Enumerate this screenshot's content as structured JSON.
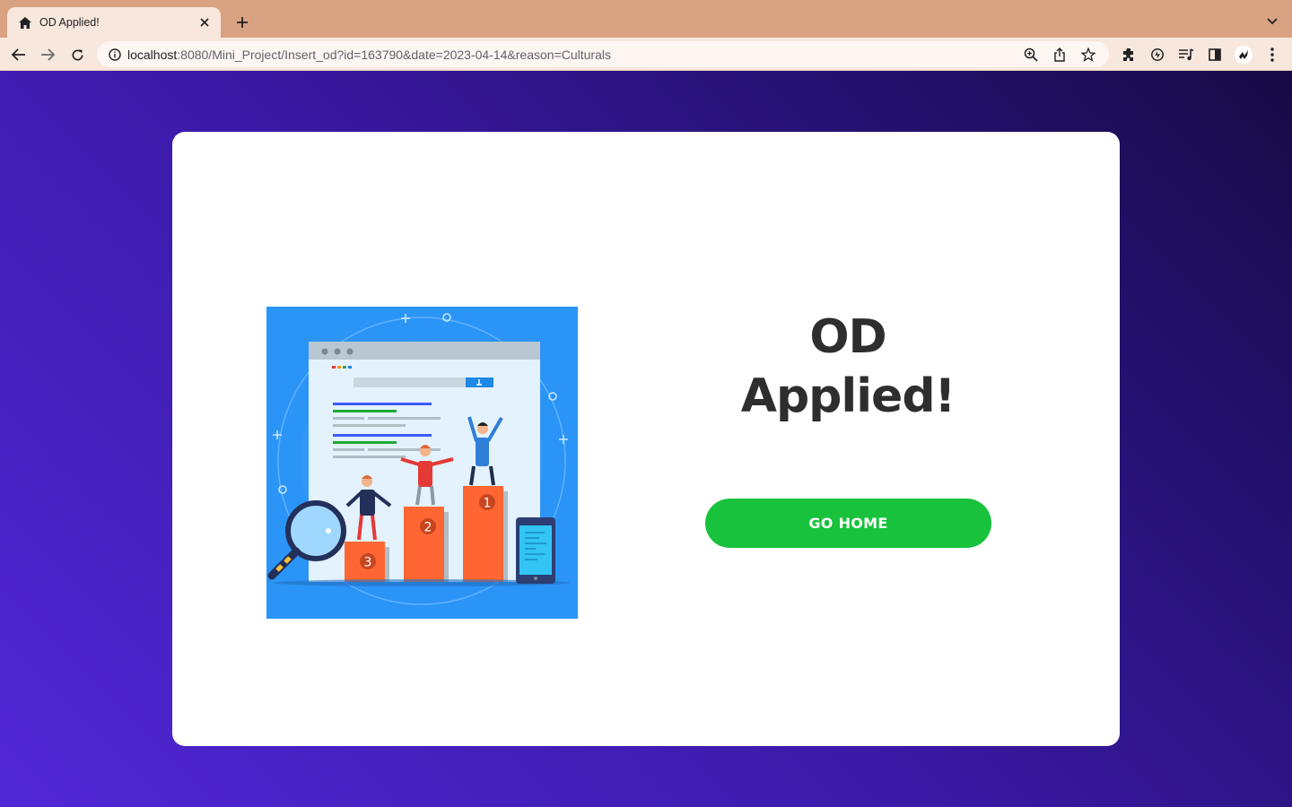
{
  "browser": {
    "tab_title": "OD Applied!",
    "url_host": "localhost",
    "url_rest": ":8080/Mini_Project/Insert_od?id=163790&date=2023-04-14&reason=Culturals",
    "icons": [
      "home-icon",
      "close-icon",
      "plus-icon",
      "chevron-down-icon",
      "back-arrow-icon",
      "forward-arrow-icon",
      "reload-icon",
      "info-icon",
      "zoom-icon",
      "share-icon",
      "star-icon",
      "extensions-icon",
      "sync-icon",
      "media-icon",
      "side-panel-icon",
      "profile-avatar",
      "menu-icon"
    ]
  },
  "page": {
    "heading_line1": "OD",
    "heading_line2": "Applied!",
    "button_label": "GO HOME",
    "podium_labels": [
      "1",
      "2",
      "3"
    ],
    "colors": {
      "button": "#18c23c",
      "bg_start": "#5128d6",
      "bg_end": "#180a45",
      "illustration_bg": "#2b94f7",
      "podium": "#ff6633"
    }
  }
}
